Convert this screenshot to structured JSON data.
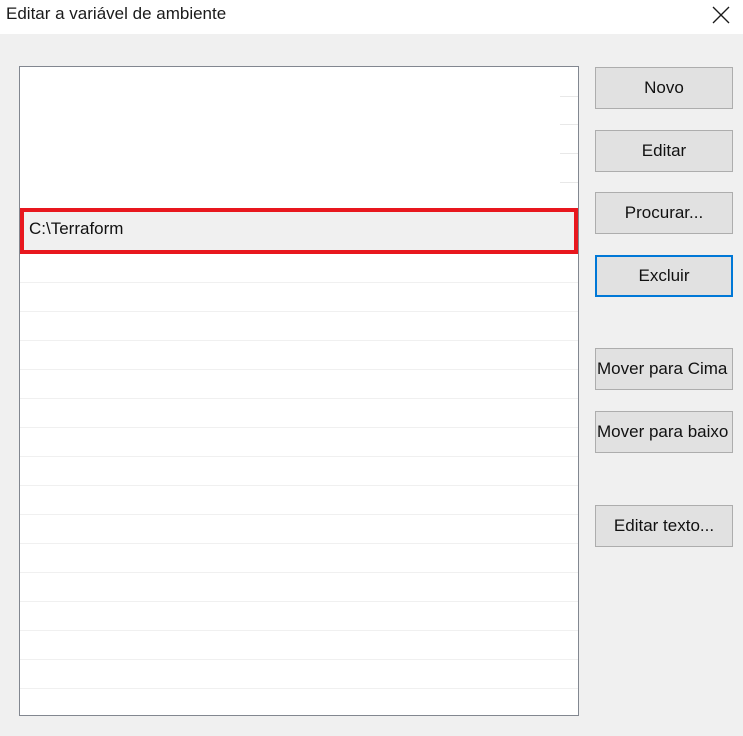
{
  "window": {
    "title": "Editar a variável de ambiente",
    "close_icon": "close-icon"
  },
  "list": {
    "items": [
      {
        "text": ""
      },
      {
        "text": ""
      },
      {
        "text": ""
      },
      {
        "text": "C:\\Terraform",
        "selected": true
      },
      {
        "text": ""
      }
    ],
    "selected_value": "C:\\Terraform",
    "highlight_color": "#e8171e"
  },
  "buttons": {
    "novo": "Novo",
    "editar": "Editar",
    "procurar": "Procurar...",
    "excluir": "Excluir",
    "mover_cima": "Mover para Cima",
    "mover_baixo": "Mover para baixo",
    "editar_texto": "Editar texto..."
  },
  "focus_color": "#0078d7"
}
